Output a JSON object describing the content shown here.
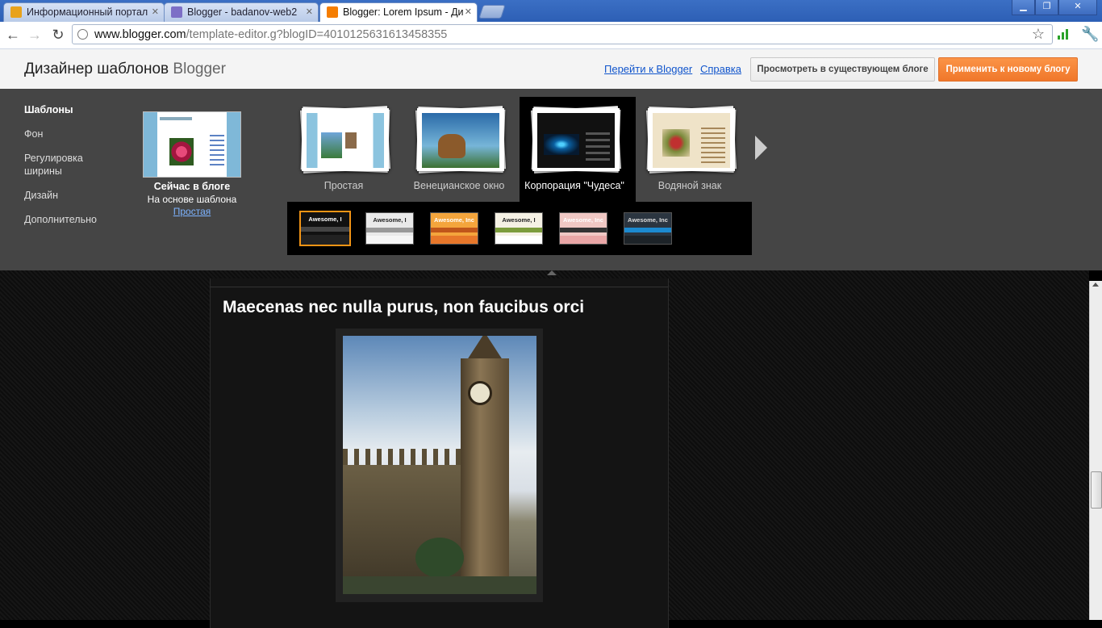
{
  "browser": {
    "tabs": [
      {
        "title": "Информационный портал",
        "color": "#e8a21c"
      },
      {
        "title": "Blogger - badanov-web2",
        "color": "#7d6fc6"
      },
      {
        "title": "Blogger: Lorem Ipsum - Ди",
        "color": "#f57d00"
      }
    ],
    "url_host": "www.blogger.com",
    "url_path": "/template-editor.g?blogID=4010125631613458355"
  },
  "header": {
    "title": "Дизайнер шаблонов",
    "title_brand": "Blogger",
    "link_go_blogger": "Перейти к Blogger",
    "link_help": "Справка",
    "btn_view_existing": "Просмотреть в существующем блоге",
    "btn_apply_new": "Применить к новому блогу",
    "accent": "#f57d00"
  },
  "sidebar": {
    "items": [
      {
        "label": "Шаблоны",
        "active": true
      },
      {
        "label": "Фон"
      },
      {
        "label": "Регулировка ширины"
      },
      {
        "label": "Дизайн"
      },
      {
        "label": "Дополнительно"
      }
    ]
  },
  "current": {
    "title": "Сейчас в блоге",
    "subtitle": "На основе шаблона",
    "link": "Простая"
  },
  "templates": [
    {
      "label": "Простая"
    },
    {
      "label": "Венецианское окно"
    },
    {
      "label": "Корпорация \"Чудеса\"",
      "selected": true
    },
    {
      "label": "Водяной знак"
    }
  ],
  "variants": [
    {
      "text": "Awesome, I",
      "bg": "#111",
      "fg": "#fff",
      "nav": "#444",
      "body": "#222",
      "selected": true
    },
    {
      "text": "Awesome, I",
      "bg": "#e9e9e9",
      "fg": "#222",
      "nav": "#999",
      "body": "#f5f5f5"
    },
    {
      "text": "Awesome, Inc",
      "bg": "#f4a53c",
      "fg": "#fff",
      "nav": "#c0561a",
      "body": "#e7772a"
    },
    {
      "text": "Awesome, I",
      "bg": "#f5f1e4",
      "fg": "#222",
      "nav": "#7c9c3c",
      "body": "#fff"
    },
    {
      "text": "Awesome, Inc",
      "bg": "#f0c8c4",
      "fg": "#fff",
      "nav": "#333",
      "body": "#e9a6a6"
    },
    {
      "text": "Awesome, Inc",
      "bg": "#2b3540",
      "fg": "#ddd",
      "nav": "#1c8ad0",
      "body": "#1d2328"
    }
  ],
  "post": {
    "title": "Maecenas nec nulla purus, non faucibus orci"
  }
}
